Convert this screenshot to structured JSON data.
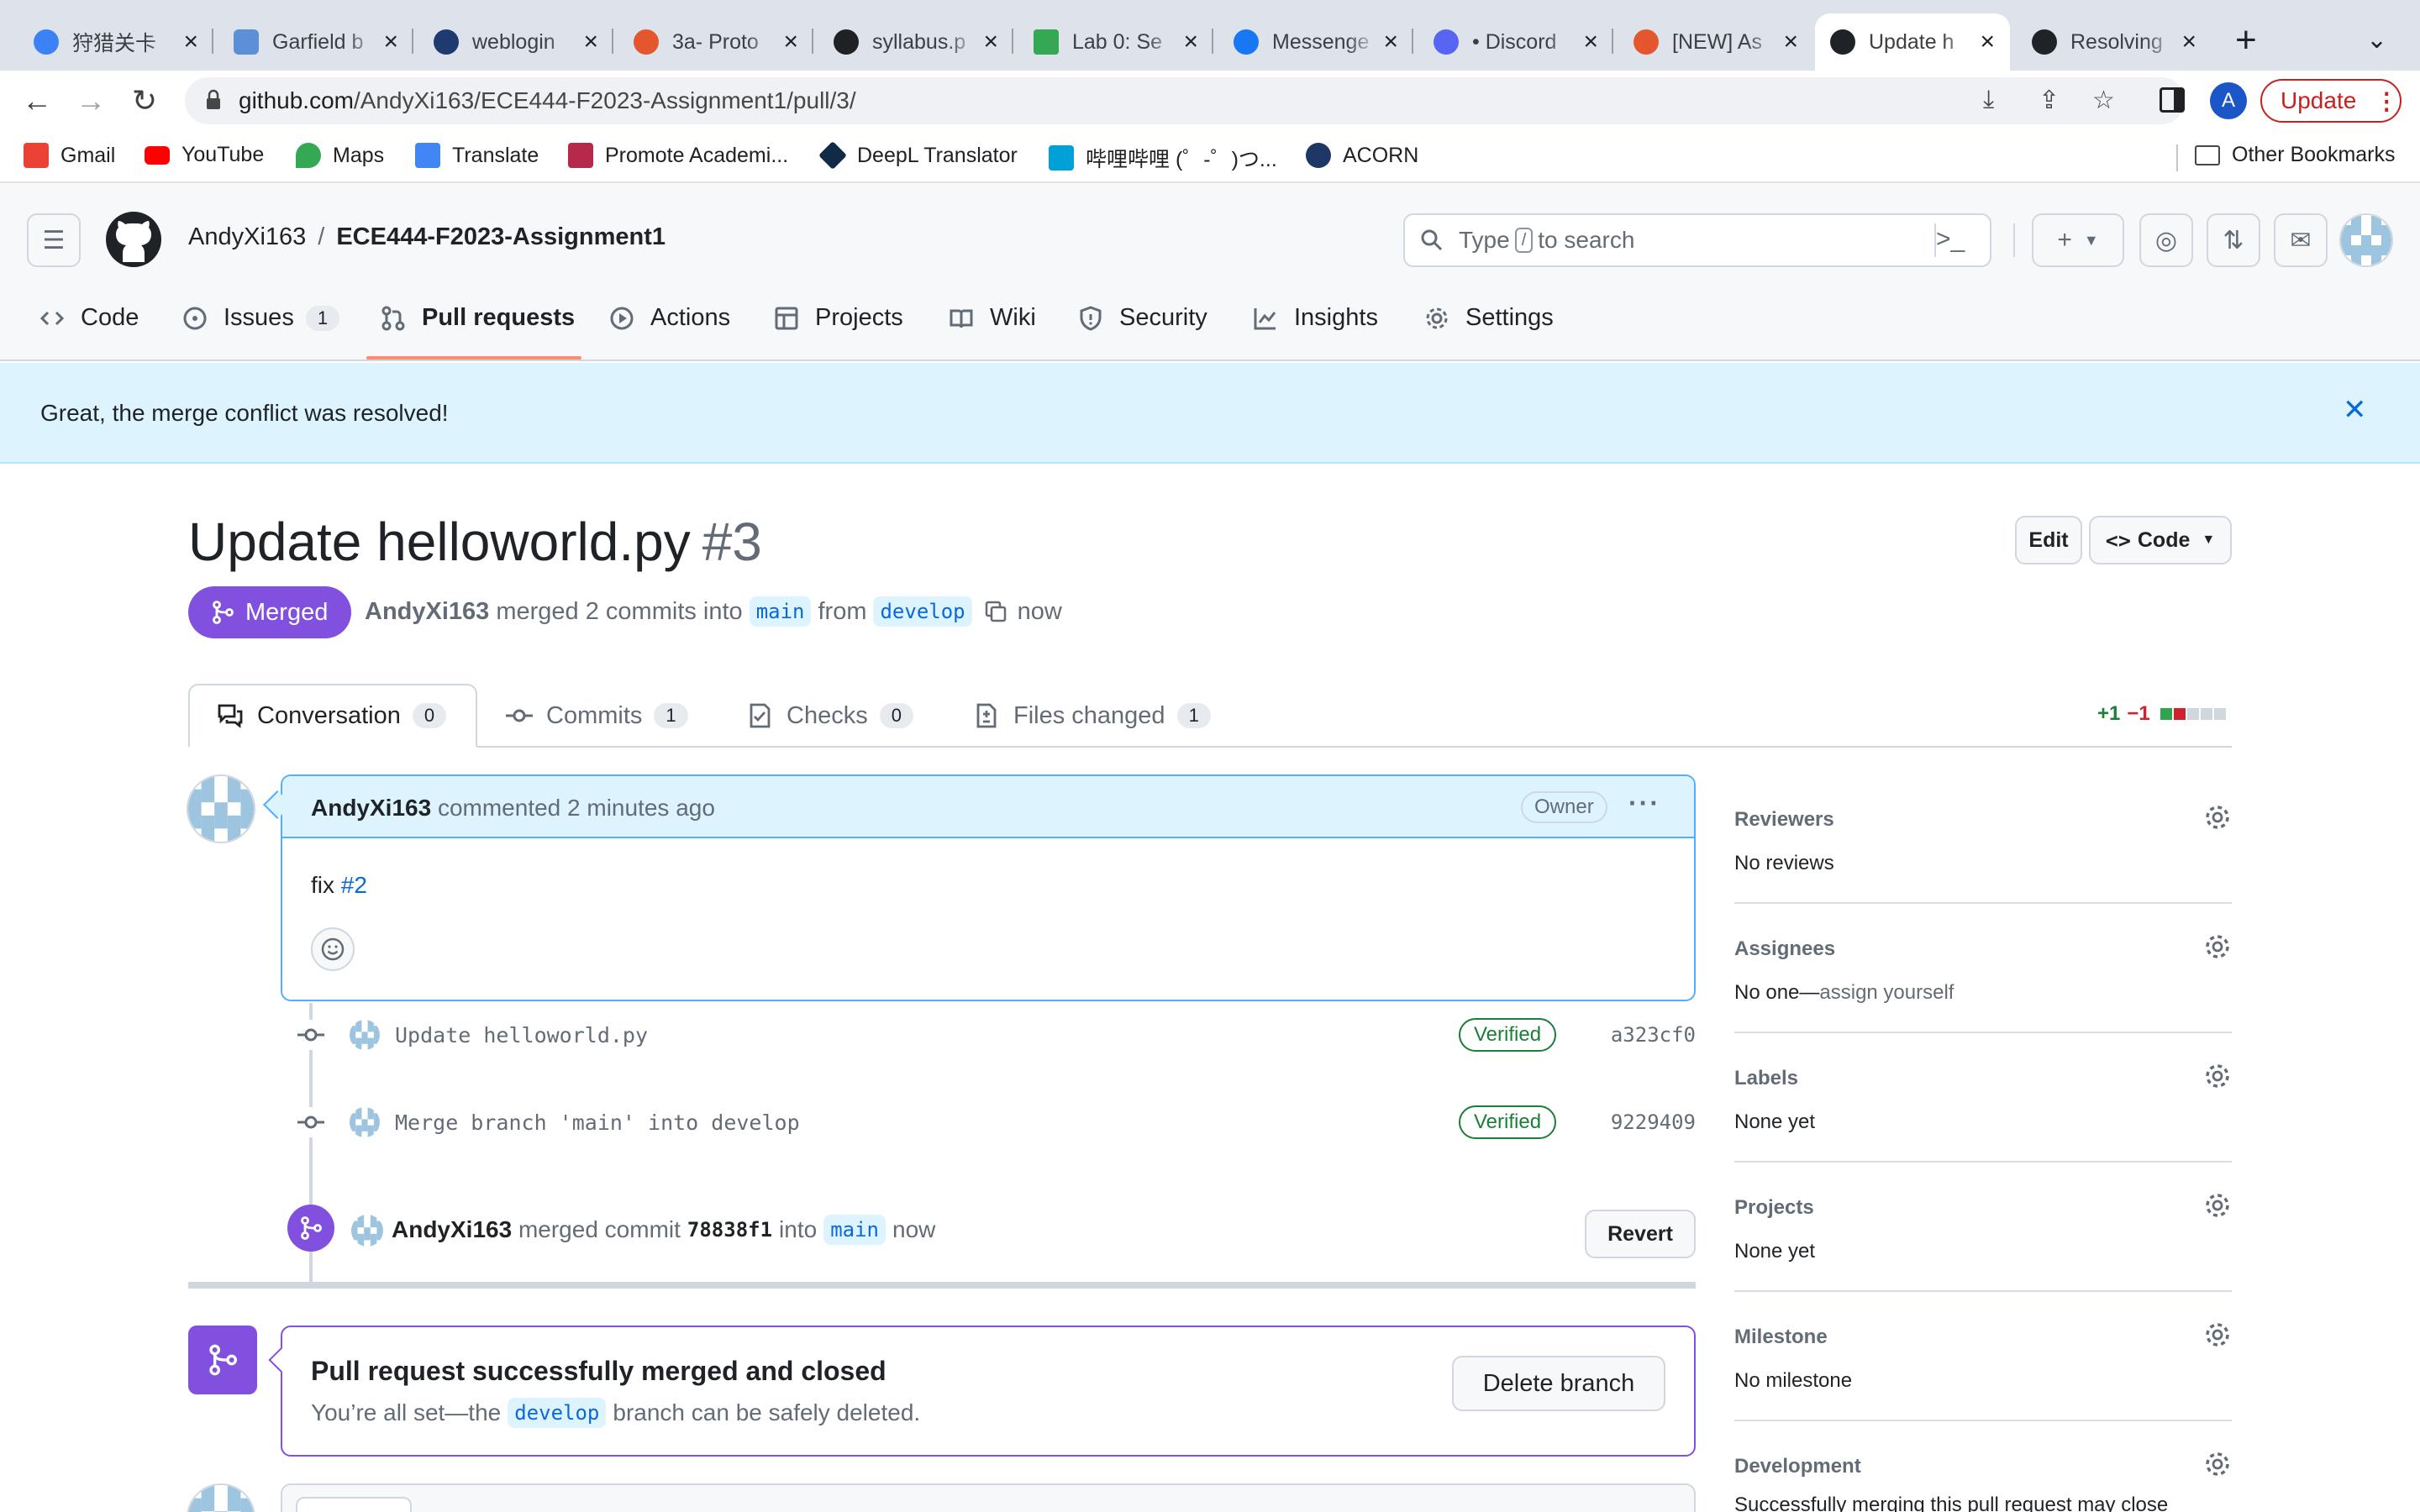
{
  "browser": {
    "tabs": [
      {
        "title": "狩猎关卡",
        "favicon_color": "#3b82f6"
      },
      {
        "title": "Garfield b",
        "favicon_color": "#5b8fd6"
      },
      {
        "title": "weblogin",
        "favicon_color": "#1e3a6e"
      },
      {
        "title": "3a- Proto",
        "favicon_color": "#e4572e"
      },
      {
        "title": "syllabus.p",
        "favicon_color": "#202124"
      },
      {
        "title": "Lab 0: Se",
        "favicon_color": "#34a853"
      },
      {
        "title": "Messenge",
        "favicon_color": "#1877f2"
      },
      {
        "title": "• Discord",
        "favicon_color": "#5865f2"
      },
      {
        "title": "[NEW] As",
        "favicon_color": "#e4572e"
      },
      {
        "title": "Update h",
        "favicon_color": "#1f2328",
        "active": true
      },
      {
        "title": "Resolving",
        "favicon_color": "#1f2328"
      }
    ],
    "url_host": "github.com",
    "url_path": "/AndyXi163/ECE444-F2023-Assignment1/pull/3/",
    "profile_initial": "A",
    "update_label": "Update",
    "bookmarks": [
      {
        "label": "Gmail",
        "icon": "gmail-icon",
        "color": "#ea4335"
      },
      {
        "label": "YouTube",
        "icon": "youtube-icon",
        "color": "#ff0000"
      },
      {
        "label": "Maps",
        "icon": "maps-icon",
        "color": "#34a853"
      },
      {
        "label": "Translate",
        "icon": "translate-icon",
        "color": "#4285f4"
      },
      {
        "label": "Promote Academi...",
        "icon": "promote-icon",
        "color": "#b5294a"
      },
      {
        "label": "DeepL Translator",
        "icon": "deepl-icon",
        "color": "#0f2b46"
      },
      {
        "label": "哔哩哔哩 (゜-゜)つ...",
        "icon": "bilibili-icon",
        "color": "#00a1d6"
      },
      {
        "label": "ACORN",
        "icon": "acorn-icon",
        "color": "#1e3765"
      }
    ],
    "other_bookmarks": "Other Bookmarks"
  },
  "github": {
    "owner": "AndyXi163",
    "repo": "ECE444-F2023-Assignment1",
    "search_prefix": "Type",
    "search_key": "/",
    "search_suffix": "to search",
    "nav": [
      {
        "label": "Code",
        "icon": "code-icon"
      },
      {
        "label": "Issues",
        "icon": "issue-icon",
        "count": "1"
      },
      {
        "label": "Pull requests",
        "icon": "pull-request-icon",
        "selected": true
      },
      {
        "label": "Actions",
        "icon": "play-icon"
      },
      {
        "label": "Projects",
        "icon": "table-icon"
      },
      {
        "label": "Wiki",
        "icon": "book-icon"
      },
      {
        "label": "Security",
        "icon": "shield-icon"
      },
      {
        "label": "Insights",
        "icon": "graph-icon"
      },
      {
        "label": "Settings",
        "icon": "gear-icon"
      }
    ]
  },
  "flash": {
    "message": "Great, the merge conflict was resolved!"
  },
  "pr": {
    "title": "Update helloworld.py",
    "number": "#3",
    "state": "Merged",
    "author": "AndyXi163",
    "meta_merged": "merged 2 commits into",
    "base": "main",
    "meta_from": "from",
    "head": "develop",
    "time": "now",
    "edit_label": "Edit",
    "code_label": "Code",
    "tabs": [
      {
        "label": "Conversation",
        "count": "0",
        "icon": "comment-discussion-icon"
      },
      {
        "label": "Commits",
        "count": "1",
        "icon": "commit-icon"
      },
      {
        "label": "Checks",
        "count": "0",
        "icon": "checklist-icon"
      },
      {
        "label": "Files changed",
        "count": "1",
        "icon": "file-diff-icon"
      }
    ],
    "diff_add": "+1",
    "diff_del": "−1"
  },
  "comment": {
    "author": "AndyXi163",
    "action": "commented 2 minutes ago",
    "role": "Owner",
    "body_prefix": "fix",
    "body_link": "#2"
  },
  "commits": [
    {
      "message": "Update helloworld.py",
      "status": "Verified",
      "sha": "a323cf0"
    },
    {
      "message": "Merge branch 'main' into develop",
      "status": "Verified",
      "sha": "9229409"
    }
  ],
  "merge_event": {
    "author": "AndyXi163",
    "text": "merged commit",
    "sha": "78838f1",
    "into": "into",
    "branch": "main",
    "time": "now",
    "revert_label": "Revert"
  },
  "merged_box": {
    "title": "Pull request successfully merged and closed",
    "sub_prefix": "You’re all set—the",
    "branch": "develop",
    "sub_suffix": "branch can be safely deleted.",
    "delete_label": "Delete branch"
  },
  "sidebar": [
    {
      "title": "Reviewers",
      "value": "No reviews"
    },
    {
      "title": "Assignees",
      "value": "No one—",
      "value_extra": "assign yourself"
    },
    {
      "title": "Labels",
      "value": "None yet"
    },
    {
      "title": "Projects",
      "value": "None yet"
    },
    {
      "title": "Milestone",
      "value": "No milestone"
    },
    {
      "title": "Development",
      "value": "Successfully merging this pull request may close"
    }
  ]
}
